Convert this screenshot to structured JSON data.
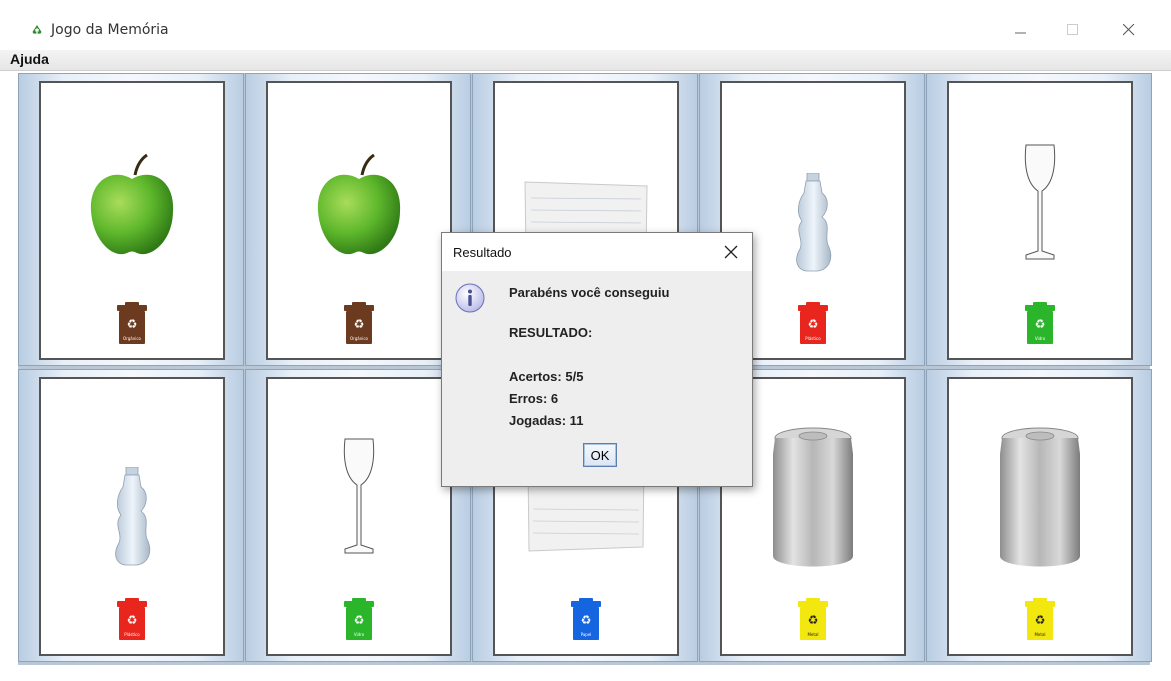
{
  "window": {
    "title": "Jogo da Memória",
    "controls": [
      "minimize",
      "maximize",
      "close"
    ]
  },
  "menu": {
    "items": [
      "Ajuda"
    ]
  },
  "board": {
    "cards": [
      {
        "item": "apple",
        "bin_color": "#6b3a1f",
        "bin_label": "Orgânico"
      },
      {
        "item": "apple",
        "bin_color": "#6b3a1f",
        "bin_label": "Orgânico"
      },
      {
        "item": "paper",
        "bin_color": "#6b3a1f",
        "bin_label": ""
      },
      {
        "item": "plastic-bottle",
        "bin_color": "#e8261d",
        "bin_label": "Plástico"
      },
      {
        "item": "wine-glass",
        "bin_color": "#2bb52b",
        "bin_label": "Vidro"
      },
      {
        "item": "plastic-bottle",
        "bin_color": "#e8261d",
        "bin_label": "Plástico"
      },
      {
        "item": "wine-glass",
        "bin_color": "#2bb52b",
        "bin_label": "Vidro"
      },
      {
        "item": "paper",
        "bin_color": "#1565e0",
        "bin_label": "Papel"
      },
      {
        "item": "aluminum-can",
        "bin_color": "#f2e70f",
        "bin_label": "Metal"
      },
      {
        "item": "aluminum-can",
        "bin_color": "#f2e70f",
        "bin_label": "Metal"
      }
    ]
  },
  "dialog": {
    "title": "Resultado",
    "message": "Parabéns você conseguiu",
    "result_heading": "RESULTADO:",
    "hits": "Acertos: 5/5",
    "errors": "Erros: 6",
    "moves": "Jogadas: 11",
    "ok_label": "OK"
  }
}
